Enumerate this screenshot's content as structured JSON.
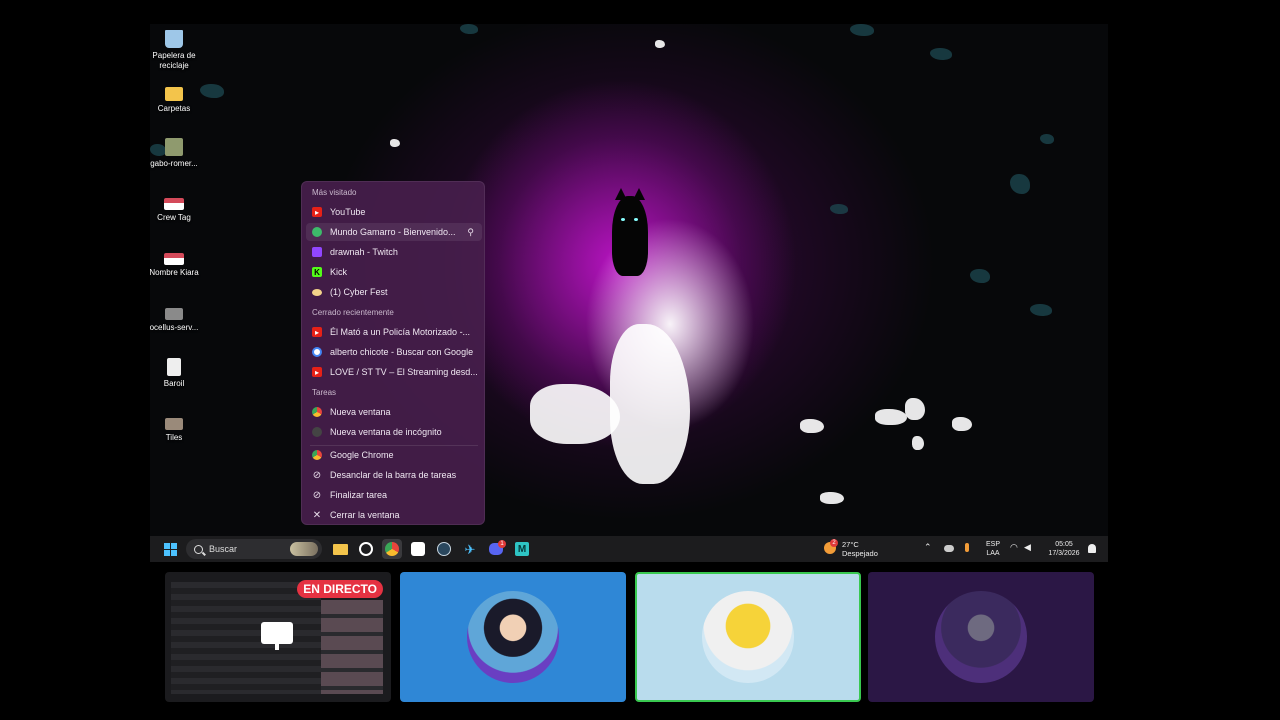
{
  "desktop_icons": [
    {
      "label": "Papelera de reciclaje",
      "icon": "recycle-bin-icon",
      "color": "#9ec7e8"
    },
    {
      "label": "Carpetas",
      "icon": "folder-icon",
      "color": "#f3c44b"
    },
    {
      "label": "gabo-romer...",
      "icon": "image-file-icon",
      "color": "#8f9a6e"
    },
    {
      "label": "Crew Tag",
      "icon": "image-file-icon",
      "color": "#d44a5a"
    },
    {
      "label": "Nombre Kiara",
      "icon": "image-file-icon",
      "color": "#d44a5a"
    },
    {
      "label": "ocellus-serv...",
      "icon": "image-file-icon",
      "color": "#8a8a8a"
    },
    {
      "label": "Baroil",
      "icon": "file-icon",
      "color": "#eeeeee"
    },
    {
      "label": "Tiles",
      "icon": "image-file-icon",
      "color": "#9a8a7a"
    }
  ],
  "jumplist": {
    "sections": {
      "most_visited": "Más visitado",
      "recently_closed": "Cerrado recientemente",
      "tasks": "Tareas"
    },
    "most_visited": [
      {
        "label": "YouTube",
        "icon": "youtube-icon",
        "color": "#e62117"
      },
      {
        "label": "Mundo Gamarro - Bienvenido...",
        "icon": "site-icon",
        "color": "#3dbb6a"
      },
      {
        "label": "drawnah - Twitch",
        "icon": "twitch-icon",
        "color": "#9146ff"
      },
      {
        "label": "Kick",
        "icon": "kick-icon",
        "color": "#53fc18"
      },
      {
        "label": "(1) Cyber Fest",
        "icon": "site-icon",
        "color": "#f2d28a"
      }
    ],
    "recently_closed": [
      {
        "label": "Él Mató a un Policía Motorizado -...",
        "icon": "youtube-icon",
        "color": "#e62117"
      },
      {
        "label": "alberto chicote - Buscar con Google",
        "icon": "google-icon",
        "color": "#ffffff"
      },
      {
        "label": "LOVE / ST TV – El Streaming desd...",
        "icon": "youtube-icon",
        "color": "#e62117"
      }
    ],
    "tasks": [
      {
        "label": "Nueva ventana",
        "icon": "chrome-icon",
        "color": "#e8453c"
      },
      {
        "label": "Nueva ventana de incógnito",
        "icon": "incognito-icon",
        "color": "#444444"
      }
    ],
    "actions": [
      {
        "label": "Google Chrome",
        "icon": "chrome-icon",
        "color": "#e8453c"
      },
      {
        "label": "Desanclar de la barra de tareas",
        "icon": "unpin-icon",
        "color": ""
      },
      {
        "label": "Finalizar tarea",
        "icon": "end-task-icon",
        "color": ""
      },
      {
        "label": "Cerrar la ventana",
        "icon": "close-icon",
        "color": ""
      }
    ]
  },
  "taskbar": {
    "search_placeholder": "Buscar",
    "weather_temp": "27°C",
    "weather_desc": "Despejado",
    "weather_badge": "2",
    "lang_top": "ESP",
    "lang_bottom": "LAA",
    "time": "05:05",
    "date": "17/3/2026",
    "discord_badge": "1"
  },
  "stream": {
    "live_label": "EN DIRECTO"
  },
  "colors": {
    "taskbar_bg": "#1c1c1e",
    "jumplist_bg": "#461e4b",
    "tile_blue": "#2f87d6",
    "tile_lightblue": "#b9dced",
    "tile_purple": "#2b1745",
    "active_border": "#39c850",
    "live_red": "#e53242"
  }
}
